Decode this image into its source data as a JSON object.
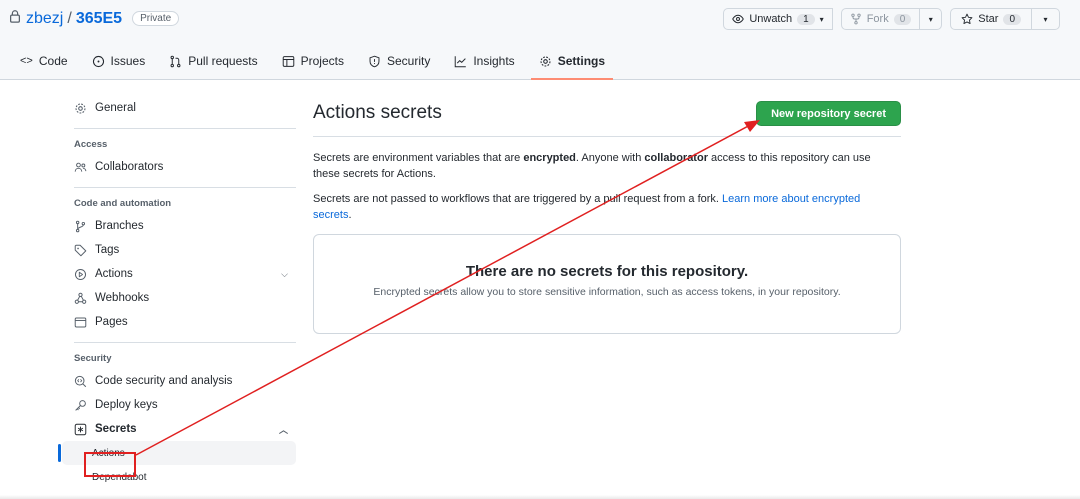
{
  "repo": {
    "owner": "zbezj",
    "separator": "/",
    "name": "365E5",
    "visibility": "Private"
  },
  "header_actions": {
    "watch_label": "Unwatch",
    "watch_count": "1",
    "fork_label": "Fork",
    "fork_count": "0",
    "star_label": "Star",
    "star_count": "0"
  },
  "tabs": {
    "code": "Code",
    "issues": "Issues",
    "pulls": "Pull requests",
    "projects": "Projects",
    "security": "Security",
    "insights": "Insights",
    "settings": "Settings"
  },
  "sidebar": {
    "general": "General",
    "access_heading": "Access",
    "collaborators": "Collaborators",
    "code_automation_heading": "Code and automation",
    "branches": "Branches",
    "tags": "Tags",
    "actions": "Actions",
    "webhooks": "Webhooks",
    "pages": "Pages",
    "security_heading": "Security",
    "code_security": "Code security and analysis",
    "deploy_keys": "Deploy keys",
    "secrets": "Secrets",
    "secrets_actions": "Actions",
    "secrets_dependabot": "Dependabot"
  },
  "main": {
    "title": "Actions secrets",
    "new_secret_button": "New repository secret",
    "p1_a": "Secrets are environment variables that are ",
    "p1_b": "encrypted",
    "p1_c": ". Anyone with ",
    "p1_d": "collaborator",
    "p1_e": " access to this repository can use these secrets for Actions.",
    "p2_a": "Secrets are not passed to workflows that are triggered by a pull request from a fork. ",
    "p2_link": "Learn more about encrypted secrets",
    "p2_end": ".",
    "empty_title": "There are no secrets for this repository.",
    "empty_desc": "Encrypted secrets allow you to store sensitive information, such as access tokens, in your repository."
  },
  "colors": {
    "accent_blue": "#0969da",
    "button_green": "#2da44e",
    "annotation_red": "#e02020",
    "tab_underline": "#fd8c73"
  }
}
